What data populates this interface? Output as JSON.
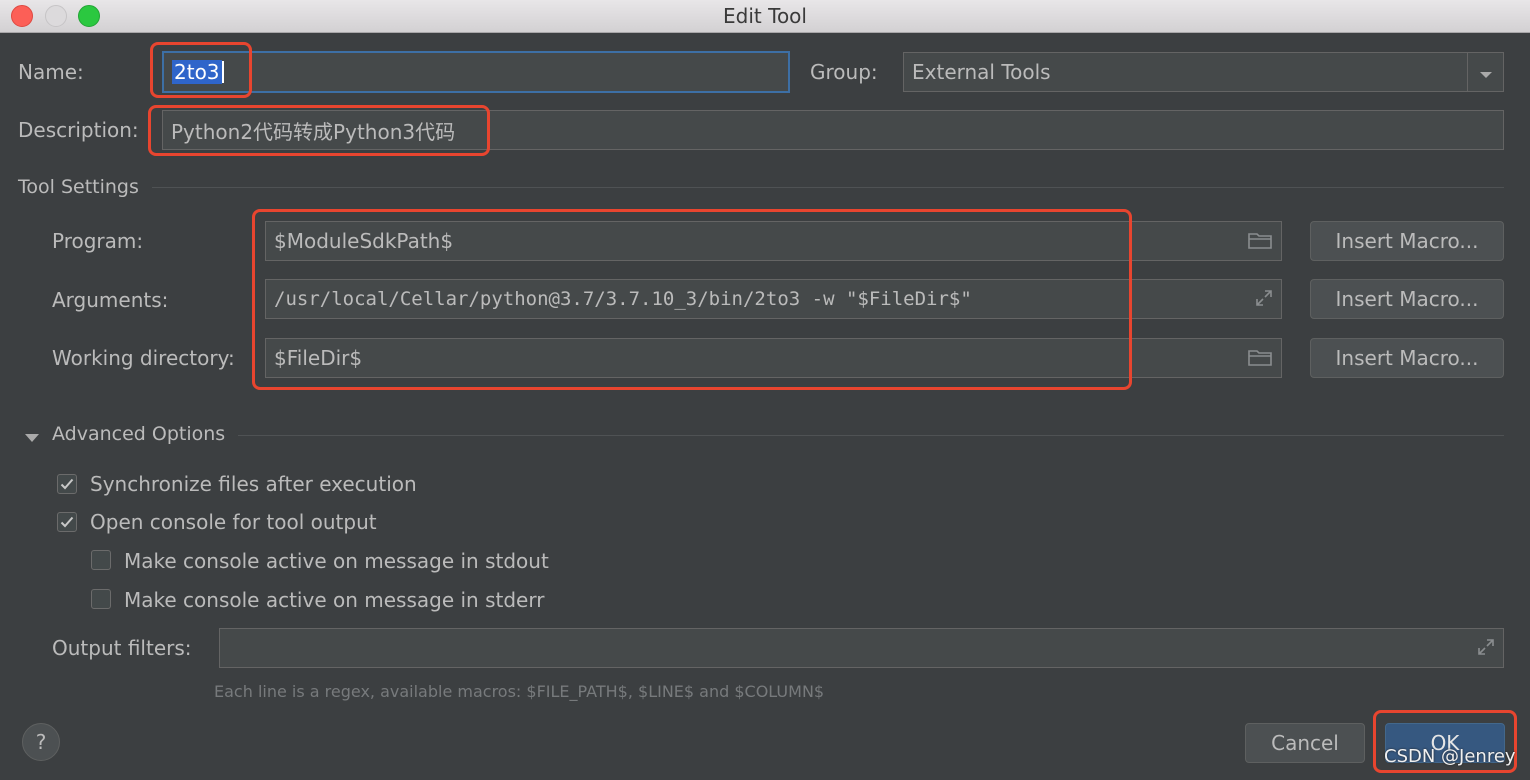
{
  "window": {
    "title": "Edit Tool"
  },
  "name": {
    "label": "Name:",
    "value": "2to3"
  },
  "group": {
    "label": "Group:",
    "value": "External Tools"
  },
  "description": {
    "label": "Description:",
    "value": "Python2代码转成Python3代码"
  },
  "tool_settings": {
    "header": "Tool Settings",
    "program": {
      "label": "Program:",
      "value": "$ModuleSdkPath$",
      "macro_button": "Insert Macro..."
    },
    "arguments": {
      "label": "Arguments:",
      "value": "/usr/local/Cellar/python@3.7/3.7.10_3/bin/2to3 -w \"$FileDir$\"",
      "macro_button": "Insert Macro..."
    },
    "working_directory": {
      "label": "Working directory:",
      "value": "$FileDir$",
      "macro_button": "Insert Macro..."
    }
  },
  "advanced": {
    "header": "Advanced Options",
    "options": [
      {
        "label": "Synchronize files after execution",
        "checked": true
      },
      {
        "label": "Open console for tool output",
        "checked": true
      },
      {
        "label": "Make console active on message in stdout",
        "checked": false
      },
      {
        "label": "Make console active on message in stderr",
        "checked": false
      }
    ],
    "output_filters": {
      "label": "Output filters:",
      "value": ""
    },
    "hint": "Each line is a regex, available macros: $FILE_PATH$, $LINE$ and $COLUMN$"
  },
  "footer": {
    "help": "?",
    "cancel": "Cancel",
    "ok": "OK",
    "watermark": "CSDN @Jenrey"
  },
  "colors": {
    "background": "#3c3f41",
    "highlight": "#e8452f",
    "ok_button": "#365880",
    "selection": "#2f65ca"
  }
}
